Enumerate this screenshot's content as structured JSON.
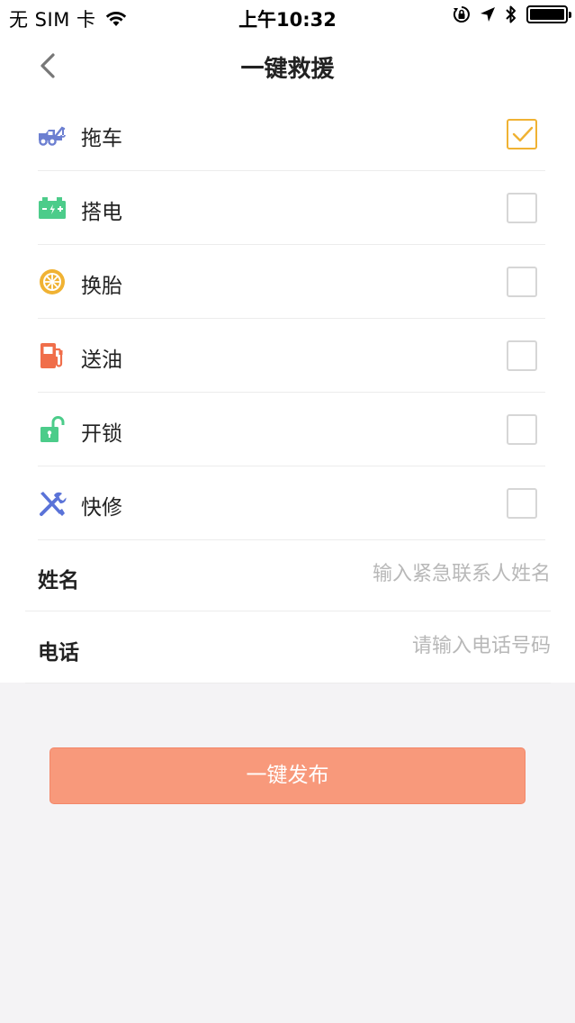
{
  "status_bar": {
    "carrier": "无 SIM 卡",
    "time": "上午10:32",
    "icons": [
      "wifi-icon",
      "orientation-lock-icon",
      "location-icon",
      "bluetooth-icon",
      "battery-icon"
    ]
  },
  "nav": {
    "back_icon": "chevron-left-icon",
    "title": "一键救援"
  },
  "services": [
    {
      "key": "tow",
      "label": "拖车",
      "icon": "tow-truck-icon",
      "checked": true
    },
    {
      "key": "jump",
      "label": "搭电",
      "icon": "battery-icon",
      "checked": false
    },
    {
      "key": "tire",
      "label": "换胎",
      "icon": "tire-icon",
      "checked": false
    },
    {
      "key": "fuel",
      "label": "送油",
      "icon": "fuel-pump-icon",
      "checked": false
    },
    {
      "key": "unlock",
      "label": "开锁",
      "icon": "unlock-icon",
      "checked": false
    },
    {
      "key": "repair",
      "label": "快修",
      "icon": "tools-icon",
      "checked": false
    }
  ],
  "form": {
    "name_label": "姓名",
    "name_placeholder": "输入紧急联系人姓名",
    "name_value": "",
    "phone_label": "电话",
    "phone_placeholder": "请输入电话号码",
    "phone_value": ""
  },
  "submit_label": "一键发布",
  "colors": {
    "accent_orange": "#f8997b",
    "check_yellow": "#f0b233",
    "tow_blue": "#6c7fd1",
    "battery_green": "#4ccc8a",
    "tire_yellow": "#f0b233",
    "fuel_orange": "#f06e4a",
    "unlock_green": "#4ccc8a",
    "tools_blue": "#5a73d8"
  }
}
